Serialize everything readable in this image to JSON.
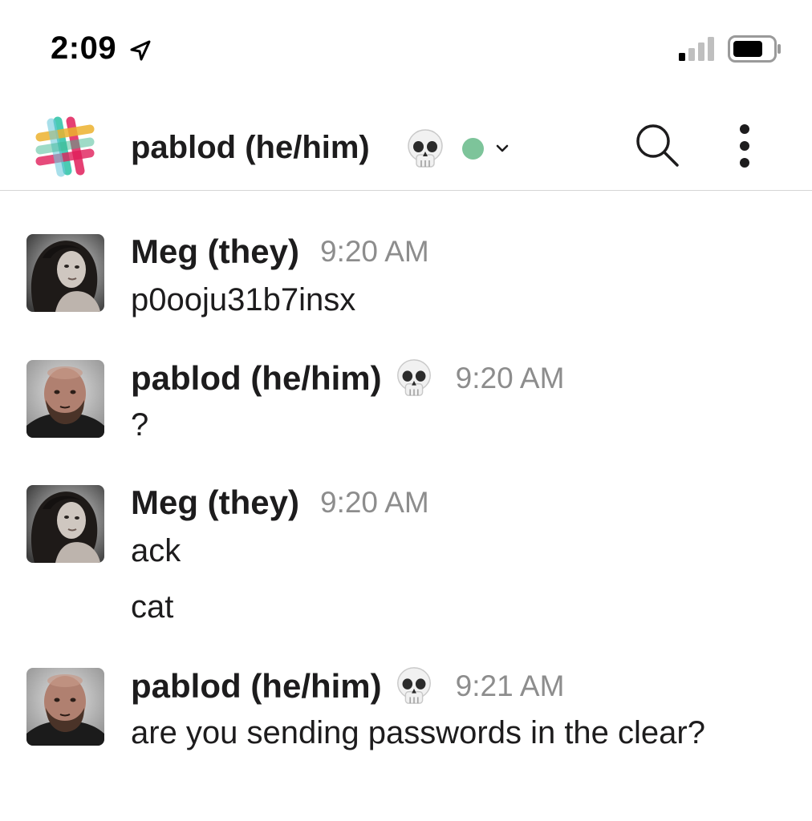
{
  "status_bar": {
    "time": "2:09",
    "location_icon": "location-arrow-icon",
    "signal_icon": "cellular-signal-icon",
    "battery_icon": "battery-icon"
  },
  "header": {
    "logo_icon": "slack-logo-icon",
    "title": "pablod (he/him)",
    "status_emoji": "skull-icon",
    "presence": "active",
    "presence_color": "#7dc49a",
    "chevron_icon": "chevron-down-icon",
    "search_icon": "search-icon",
    "more_icon": "more-vertical-icon"
  },
  "messages": [
    {
      "author": "Meg (they)",
      "time": "9:20 AM",
      "text": "p0ooju31b7insx"
    },
    {
      "author": "pablod (he/him)",
      "status_emoji": "skull-icon",
      "time": "9:20 AM",
      "text": "?"
    },
    {
      "author": "Meg (they)",
      "time": "9:20 AM",
      "text": "ack",
      "followups": [
        "cat"
      ]
    },
    {
      "author": "pablod (he/him)",
      "status_emoji": "skull-icon",
      "time": "9:21 AM",
      "text": "are you sending passwords in the clear?"
    }
  ],
  "colors": {
    "text": "#1d1c1d",
    "timestamp": "#8d8d8d",
    "divider": "#d5d5d5"
  }
}
